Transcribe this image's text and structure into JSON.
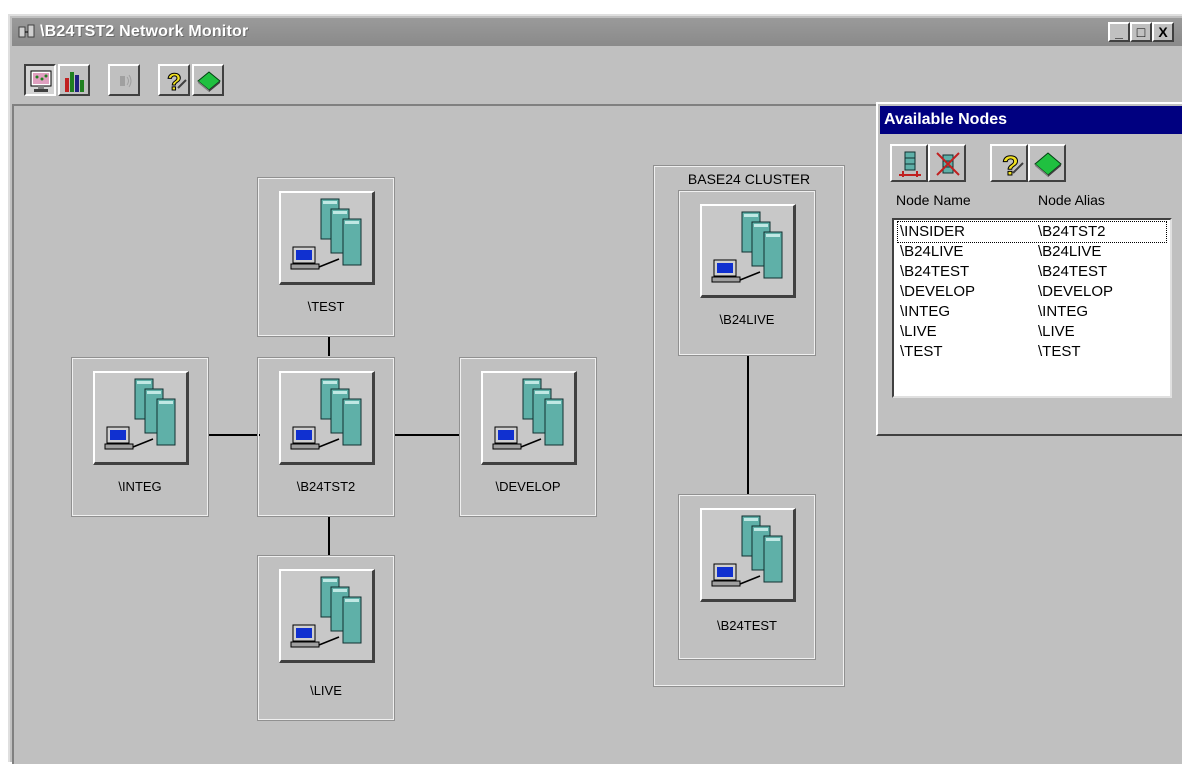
{
  "window": {
    "title": "\\B24TST2 Network Monitor",
    "controls": {
      "minimize": "_",
      "maximize": "□",
      "close": "X"
    }
  },
  "toolbar": {
    "buttons": [
      {
        "icon": "monitor-icon",
        "pressed": true
      },
      {
        "icon": "bar-chart-icon",
        "pressed": false
      },
      {
        "icon": "signal-icon",
        "pressed": false,
        "disabled": true
      },
      {
        "icon": "help-icon",
        "pressed": false
      },
      {
        "icon": "diamond-icon",
        "pressed": false
      }
    ]
  },
  "topology": {
    "nodes": {
      "test": "\\TEST",
      "integ": "\\INTEG",
      "b24tst2": "\\B24TST2",
      "develop": "\\DEVELOP",
      "live": "\\LIVE"
    },
    "cluster": {
      "title": "BASE24 CLUSTER",
      "nodes": {
        "b24live": "\\B24LIVE",
        "b24test": "\\B24TEST"
      }
    }
  },
  "available_nodes": {
    "title": "Available Nodes",
    "columns": {
      "name": "Node Name",
      "alias": "Node Alias"
    },
    "rows": [
      {
        "name": "\\INSIDER",
        "alias": "\\B24TST2"
      },
      {
        "name": "\\B24LIVE",
        "alias": "\\B24LIVE"
      },
      {
        "name": "\\B24TEST",
        "alias": "\\B24TEST"
      },
      {
        "name": "\\DEVELOP",
        "alias": "\\DEVELOP"
      },
      {
        "name": "\\INTEG",
        "alias": "\\INTEG"
      },
      {
        "name": "\\LIVE",
        "alias": "\\LIVE"
      },
      {
        "name": "\\TEST",
        "alias": "\\TEST"
      }
    ]
  },
  "colors": {
    "window_bg": "#c0c0c0",
    "panel_title_bg": "#000080",
    "server": "#5fb0a8"
  }
}
